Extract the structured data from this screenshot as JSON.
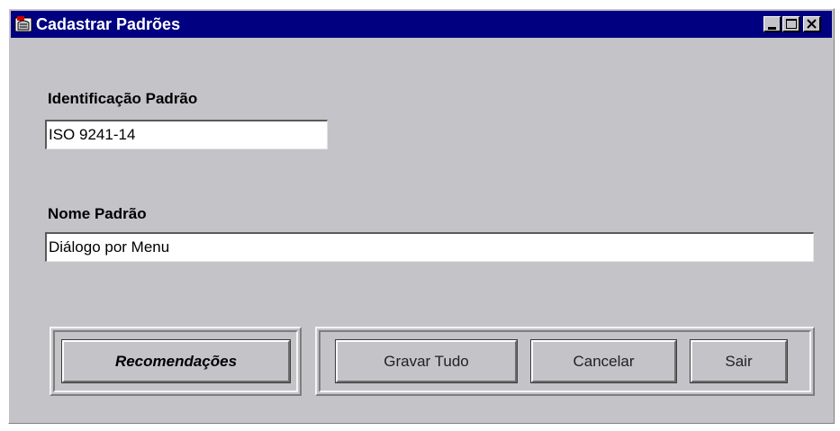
{
  "window": {
    "title": "Cadastrar Padrões",
    "icon": "app-icon",
    "controls": [
      "minimize-icon",
      "maximize-icon",
      "close-icon"
    ]
  },
  "form": {
    "id_label": "Identificação Padrão",
    "id_value": "ISO 9241-14",
    "name_label": "Nome Padrão",
    "name_value": "Diálogo por Menu"
  },
  "buttons": {
    "recommendations": "Recomendações",
    "save_all": "Gravar Tudo",
    "cancel": "Cancelar",
    "exit": "Sair"
  },
  "colors": {
    "title_bar": "#000080",
    "window_bg": "#c4c3c8"
  }
}
